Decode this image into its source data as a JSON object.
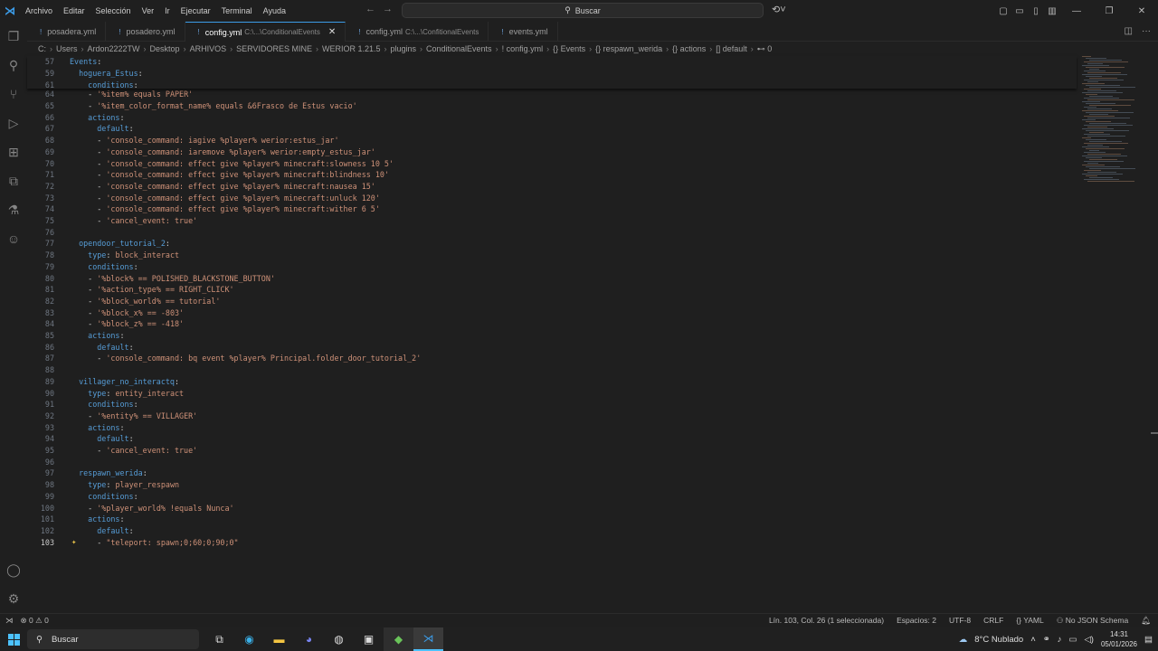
{
  "titlebar": {
    "menus": [
      "Archivo",
      "Editar",
      "Selección",
      "Ver",
      "Ir",
      "Ejecutar",
      "Terminal",
      "Ayuda"
    ],
    "search": "Buscar"
  },
  "tabs": [
    {
      "name": "posadera.yml",
      "desc": ""
    },
    {
      "name": "posadero.yml",
      "desc": ""
    },
    {
      "name": "config.yml",
      "desc": "C:\\...\\ConditionalEvents",
      "active": true
    },
    {
      "name": "config.yml",
      "desc": "C:\\...\\ConfitionalEvents"
    },
    {
      "name": "events.yml",
      "desc": ""
    }
  ],
  "breadcrumb": [
    "C:",
    "Users",
    "Ardon2222TW",
    "Desktop",
    "ARHIVOS",
    "SERVIDORES MINE",
    "WERIOR 1.21.5",
    "plugins",
    "ConditionalEvents",
    "! config.yml",
    "{} Events",
    "{} respawn_werida",
    "{} actions",
    "[] default",
    "⊷ 0"
  ],
  "sticky": [
    {
      "n": "57",
      "t": "Events:"
    },
    {
      "n": "59",
      "t": "  hoguera_Estus:"
    },
    {
      "n": "61",
      "t": "    conditions:"
    }
  ],
  "lines": [
    {
      "n": "64",
      "t": "    - '%item% equals PAPER'"
    },
    {
      "n": "65",
      "t": "    - '%item_color_format_name% equals &6Frasco de Estus vacio'"
    },
    {
      "n": "66",
      "t": "    actions:"
    },
    {
      "n": "67",
      "t": "      default:"
    },
    {
      "n": "68",
      "t": "      - 'console_command: iagive %player% werior:estus_jar'"
    },
    {
      "n": "69",
      "t": "      - 'console_command: iaremove %player% werior:empty_estus_jar'"
    },
    {
      "n": "70",
      "t": "      - 'console_command: effect give %player% minecraft:slowness 10 5'"
    },
    {
      "n": "71",
      "t": "      - 'console_command: effect give %player% minecraft:blindness 10'"
    },
    {
      "n": "72",
      "t": "      - 'console_command: effect give %player% minecraft:nausea 15'"
    },
    {
      "n": "73",
      "t": "      - 'console_command: effect give %player% minecraft:unluck 120'"
    },
    {
      "n": "74",
      "t": "      - 'console_command: effect give %player% minecraft:wither 6 5'"
    },
    {
      "n": "75",
      "t": "      - 'cancel_event: true'"
    },
    {
      "n": "76",
      "t": ""
    },
    {
      "n": "77",
      "t": "  opendoor_tutorial_2:"
    },
    {
      "n": "78",
      "t": "    type: block_interact"
    },
    {
      "n": "79",
      "t": "    conditions:"
    },
    {
      "n": "80",
      "t": "    - '%block% == POLISHED_BLACKSTONE_BUTTON'"
    },
    {
      "n": "81",
      "t": "    - '%action_type% == RIGHT_CLICK'"
    },
    {
      "n": "82",
      "t": "    - '%block_world% == tutorial'"
    },
    {
      "n": "83",
      "t": "    - '%block_x% == -803'"
    },
    {
      "n": "84",
      "t": "    - '%block_z% == -418'"
    },
    {
      "n": "85",
      "t": "    actions:"
    },
    {
      "n": "86",
      "t": "      default:"
    },
    {
      "n": "87",
      "t": "      - 'console_command: bq event %player% Principal.folder_door_tutorial_2'"
    },
    {
      "n": "88",
      "t": ""
    },
    {
      "n": "89",
      "t": "  villager_no_interactq:"
    },
    {
      "n": "90",
      "t": "    type: entity_interact"
    },
    {
      "n": "91",
      "t": "    conditions:"
    },
    {
      "n": "92",
      "t": "    - '%entity% == VILLAGER'"
    },
    {
      "n": "93",
      "t": "    actions:"
    },
    {
      "n": "94",
      "t": "      default:"
    },
    {
      "n": "95",
      "t": "      - 'cancel_event: true'"
    },
    {
      "n": "96",
      "t": ""
    },
    {
      "n": "97",
      "t": "  respawn_werida:"
    },
    {
      "n": "98",
      "t": "    type: player_respawn"
    },
    {
      "n": "99",
      "t": "    conditions:"
    },
    {
      "n": "100",
      "t": "    - '%player_world% !equals Nunca'"
    },
    {
      "n": "101",
      "t": "    actions:"
    },
    {
      "n": "102",
      "t": "      default:"
    },
    {
      "n": "103",
      "t": "      - \"teleport: spawn;0;60;0;90;0\"",
      "current": true
    }
  ],
  "status": {
    "errors": "0",
    "warnings": "0",
    "position": "Lín. 103, Col. 26 (1 seleccionada)",
    "spaces": "Espacios: 2",
    "encoding": "UTF-8",
    "eol": "CRLF",
    "language": "YAML",
    "schema": "No JSON Schema"
  },
  "taskbar": {
    "search": "Buscar",
    "weather": "8°C  Nublado",
    "time": "14:31",
    "date": "05/01/2026"
  },
  "colors": {
    "accent": "#3c9ce8",
    "key": "#569cd6",
    "string": "#ce9178"
  }
}
